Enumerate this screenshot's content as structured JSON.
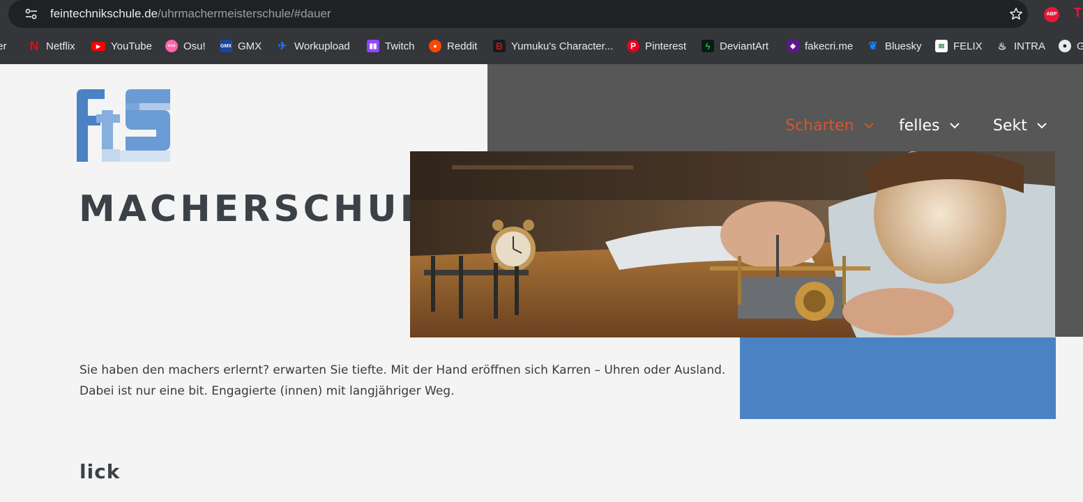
{
  "browser": {
    "url_domain": "feintechnikschule.de",
    "url_path": "/uhrmachermeisterschule/#dauer",
    "extensions": {
      "abp_label": "ABP",
      "ext2_label": "T"
    },
    "bookmarks": [
      {
        "label": "ter",
        "icon": "twitter-icon",
        "color": "#35363a"
      },
      {
        "label": "Netflix",
        "icon": "netflix-icon",
        "color": "#e50914"
      },
      {
        "label": "YouTube",
        "icon": "youtube-icon",
        "color": "#ff0000"
      },
      {
        "label": "Osu!",
        "icon": "osu-icon",
        "color": "#ff66aa"
      },
      {
        "label": "GMX",
        "icon": "gmx-icon",
        "color": "#1c449b"
      },
      {
        "label": "Workupload",
        "icon": "workupload-icon",
        "color": "#1a73e8"
      },
      {
        "label": "Twitch",
        "icon": "twitch-icon",
        "color": "#9146ff"
      },
      {
        "label": "Reddit",
        "icon": "reddit-icon",
        "color": "#ff4500"
      },
      {
        "label": "Yumuku's Character...",
        "icon": "yumuku-icon",
        "color": "#c4161c"
      },
      {
        "label": "Pinterest",
        "icon": "pinterest-icon",
        "color": "#e60023"
      },
      {
        "label": "DeviantArt",
        "icon": "deviantart-icon",
        "color": "#05cc47"
      },
      {
        "label": "fakecri.me",
        "icon": "fakecrime-icon",
        "color": "#8a2be2"
      },
      {
        "label": "Bluesky",
        "icon": "bluesky-icon",
        "color": "#1185fe"
      },
      {
        "label": "FELIX",
        "icon": "felix-icon",
        "color": "#2e8b57"
      },
      {
        "label": "INTRA",
        "icon": "intra-icon",
        "color": "#e8eaed"
      },
      {
        "label": "G",
        "icon": "github-icon",
        "color": "#e8eaed"
      }
    ]
  },
  "site": {
    "title": "MACHERSCHULE",
    "nav": [
      {
        "label": "Scharten",
        "active": true
      },
      {
        "label": "felles",
        "active": false
      },
      {
        "label": "Sekt",
        "active": false
      }
    ],
    "intro_line1": "Sie haben den machers erlernt? erwarten Sie tiefte. Mit der Hand eröffnen sich Karren – Uhren oder Ausland.",
    "intro_line2": "Dabei ist nur eine bit. Engagierte (innen) mit langjähriger Weg.",
    "section_heading": "lick",
    "colors": {
      "accent": "#d9542b",
      "blue": "#4a82c4",
      "dark_panel": "#575757",
      "text": "#3c4148"
    }
  }
}
